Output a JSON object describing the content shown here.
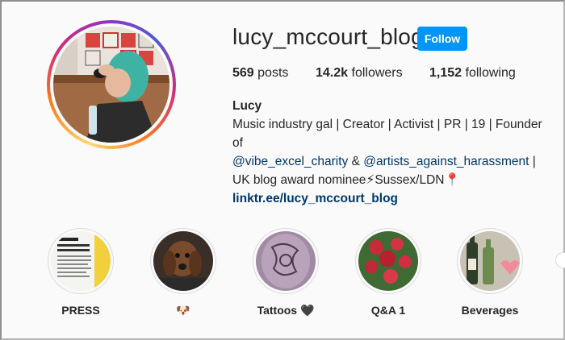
{
  "profile": {
    "username": "lucy_mccourt_blog",
    "follow_label": "Follow",
    "stats": {
      "posts_count": "569",
      "posts_label": "posts",
      "followers_count": "14.2k",
      "followers_label": "followers",
      "following_count": "1,152",
      "following_label": "following"
    },
    "bio": {
      "name": "Lucy",
      "line1": "Music industry gal | Creator | Activist | PR | 19 | Founder of",
      "mention1": "@vibe_excel_charity",
      "amp": " & ",
      "mention2": "@artists_against_harassment",
      "line2_tail": " |",
      "line3": "UK blog award nominee⚡Sussex/LDN📍",
      "link": "linktr.ee/lucy_mccourt_blog"
    }
  },
  "highlights": [
    {
      "label": "PRESS",
      "icon": "press-clipping"
    },
    {
      "label": "🐶",
      "icon": "dog-photo"
    },
    {
      "label": "Tattoos 🖤",
      "icon": "tattoo-photo"
    },
    {
      "label": "Q&A 1",
      "icon": "flowers-photo"
    },
    {
      "label": "Beverages",
      "icon": "wine-bottles-photo"
    }
  ],
  "colors": {
    "follow_button": "#0095f6",
    "mention": "#00376b",
    "text": "#262626",
    "background": "#fafafa"
  }
}
